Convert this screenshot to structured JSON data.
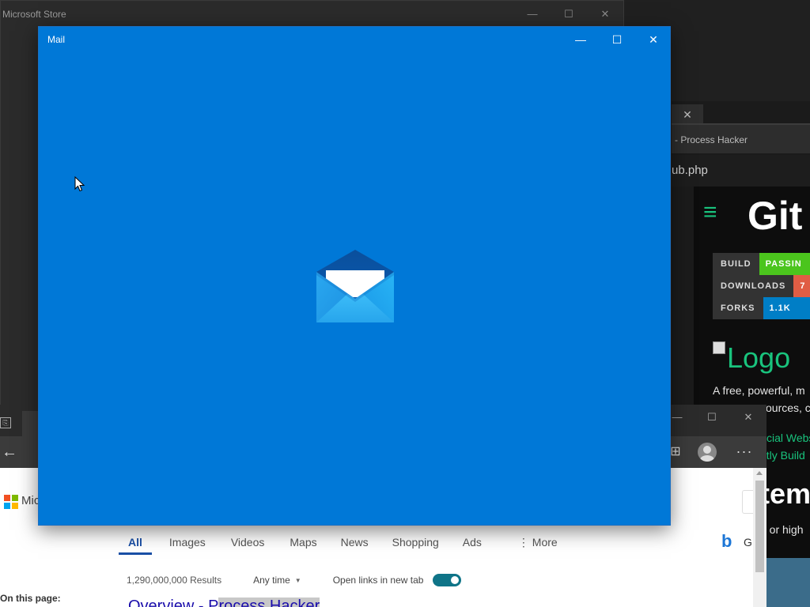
{
  "store_window": {
    "title": "Microsoft Store",
    "controls": {
      "minimize": "—",
      "maximize": "☐",
      "close": "✕"
    }
  },
  "process_hacker_window": {
    "tab_close": "✕",
    "title": "- Process Hacker",
    "url_fragment": "ub.php",
    "menu_icon": "hamburger-icon",
    "heading": "Git",
    "badges": [
      {
        "label": "BUILD",
        "value": "PASSIN",
        "color": "#4bc51d"
      },
      {
        "label": "DOWNLOADS",
        "value": "7",
        "color": "#e05d44"
      },
      {
        "label": "FORKS",
        "value": "1.1K",
        "color": "#007ec6"
      }
    ],
    "logo_alt": "Logo",
    "description_line1": "A free, powerful, m",
    "description_line2": "sources, c",
    "link1": "cial Webs",
    "link2": "ntly Build",
    "section_heading": "tem",
    "requirements": "7 or high"
  },
  "edge_window": {
    "tab_icon": "tab-actions-icon",
    "controls": {
      "minimize": "—",
      "maximize": "☐",
      "close": "✕"
    },
    "back": "←",
    "more": "···",
    "brand_partial": "Mic",
    "search_tabs": [
      "All",
      "Images",
      "Videos",
      "Maps",
      "News",
      "Shopping",
      "Ads",
      "⋮ More"
    ],
    "active_tab": "All",
    "bing_g": "G",
    "results_count": "1,290,000,000 Results",
    "any_time": "Any time",
    "open_links": "Open links in new tab",
    "open_links_enabled": true,
    "on_this_page": "On this page:",
    "first_result_prefix": "Overview - P",
    "first_result_highlight": "rocess Hacker"
  },
  "mail_window": {
    "title": "Mail",
    "controls": {
      "minimize": "—",
      "maximize": "☐",
      "close": "✕"
    },
    "background_color": "#0078d7",
    "splash_icon": "mail-envelope-icon"
  }
}
